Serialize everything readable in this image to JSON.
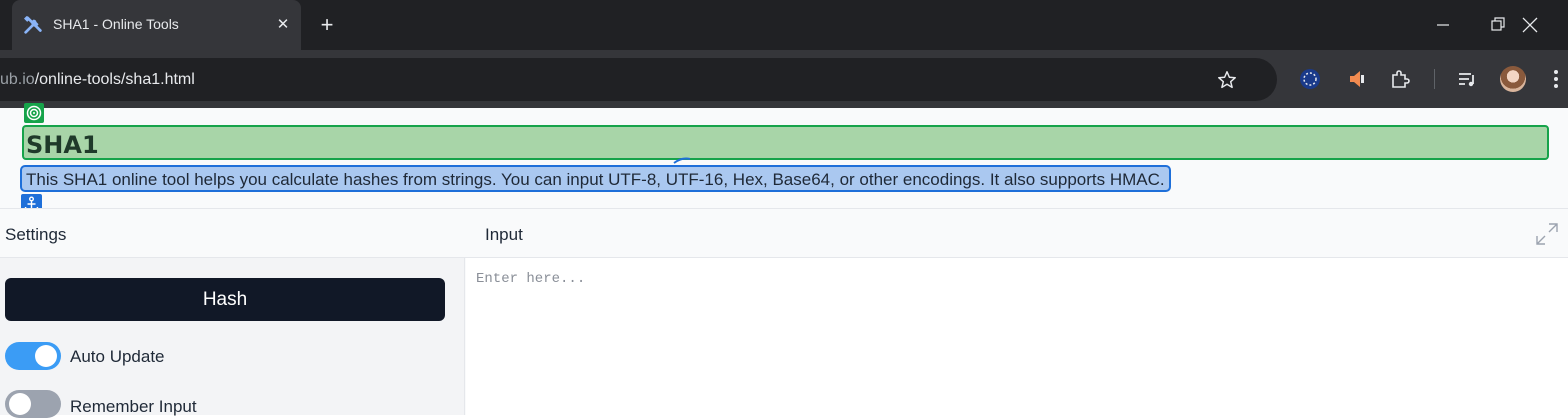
{
  "browser": {
    "tab": {
      "title": "SHA1 - Online Tools",
      "icon": "tools-icon"
    },
    "new_tab_symbol": "+",
    "close_symbol": "✕",
    "address": {
      "host": "ub.io",
      "path": "/online-tools/sha1.html"
    },
    "extensions": [
      "moon-extension-icon",
      "speaker-extension-icon",
      "puzzle-extensions-icon",
      "media-control-icon"
    ]
  },
  "page": {
    "title": "SHA1",
    "description": "This SHA1 online tool helps you calculate hashes from strings. You can input UTF-8, UTF-16, Hex, Base64, or other encodings. It also supports HMAC.",
    "settings_label": "Settings",
    "input_label": "Input",
    "hash_button": "Hash",
    "input_placeholder": "Enter here...",
    "options": [
      {
        "label": "Auto Update",
        "enabled": true
      },
      {
        "label": "Remember Input",
        "enabled": false
      }
    ]
  },
  "colors": {
    "accent_blue": "#3b9cf5",
    "button_dark": "#111827",
    "title_highlight": "#a8d5a8",
    "desc_highlight": "#aac8f0"
  }
}
